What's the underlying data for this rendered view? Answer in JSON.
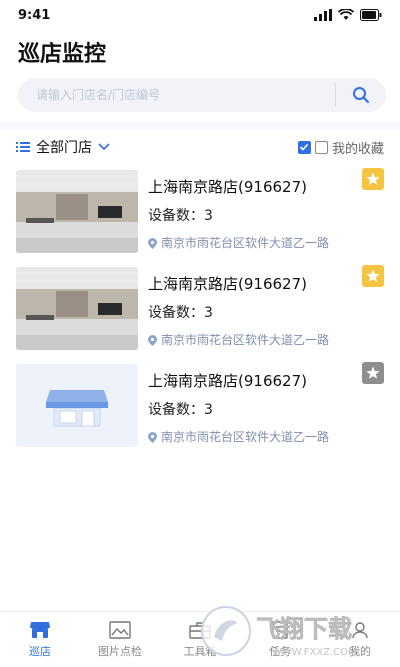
{
  "status_bar": {
    "time": "9:41"
  },
  "header": {
    "title": "巡店监控"
  },
  "search": {
    "placeholder": "请输入门店名/门店编号"
  },
  "filter": {
    "dropdown_label": "全部门店",
    "favorites_label": "我的收藏",
    "select_all_checked": true,
    "favorites_checked": false
  },
  "stores": [
    {
      "name": "上海南京路店(916627)",
      "devices": "设备数：3",
      "address": "南京市雨花台区软件大道乙一路",
      "favorited": true,
      "thumbnail": "photo"
    },
    {
      "name": "上海南京路店(916627)",
      "devices": "设备数：3",
      "address": "南京市雨花台区软件大道乙一路",
      "favorited": true,
      "thumbnail": "photo"
    },
    {
      "name": "上海南京路店(916627)",
      "devices": "设备数：3",
      "address": "南京市雨花台区软件大道乙一路",
      "favorited": false,
      "thumbnail": "placeholder"
    }
  ],
  "tabs": [
    {
      "label": "巡店",
      "icon": "store-icon",
      "active": true
    },
    {
      "label": "图片点检",
      "icon": "image-icon",
      "active": false
    },
    {
      "label": "工具箱",
      "icon": "toolbox-icon",
      "active": false
    },
    {
      "label": "任务",
      "icon": "task-icon",
      "active": false
    },
    {
      "label": "我的",
      "icon": "profile-icon",
      "active": false
    }
  ],
  "watermark": {
    "text": "飞翔下载",
    "url": "WWW.FXXZ.COM"
  },
  "colors": {
    "accent": "#2f6fe0",
    "favorite": "#f5c542",
    "address": "#7f8fb0"
  }
}
